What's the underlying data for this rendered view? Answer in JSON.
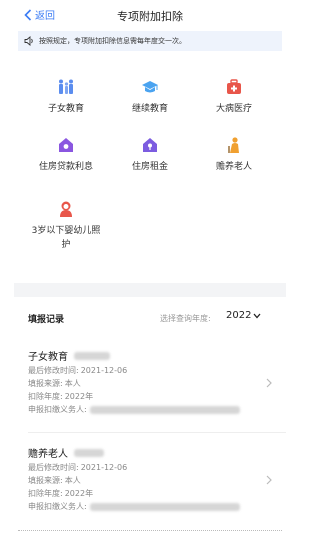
{
  "nav": {
    "back_label": "返回",
    "title": "专项附加扣除"
  },
  "notice": {
    "text": "按照规定，专项附加扣除信息需每年度交一次。"
  },
  "categories": [
    {
      "label": "子女教育",
      "icon": "children-education-icon",
      "color": "#5b8def"
    },
    {
      "label": "继续教育",
      "icon": "graduation-cap-icon",
      "color": "#4aa3f0"
    },
    {
      "label": "大病医疗",
      "icon": "medical-kit-icon",
      "color": "#e8564a"
    },
    {
      "label": "住房贷款利息",
      "icon": "house-loan-icon",
      "color": "#8a56e0"
    },
    {
      "label": "住房租金",
      "icon": "house-rent-icon",
      "color": "#7c5ce0"
    },
    {
      "label": "赡养老人",
      "icon": "elderly-care-icon",
      "color": "#f0a030"
    },
    {
      "label": "3岁以下婴幼儿照护",
      "label_line1": "3岁以下婴幼儿照",
      "label_line2": "护",
      "icon": "infant-care-icon",
      "color": "#e8564a"
    }
  ],
  "records": {
    "title": "填报记录",
    "year_label": "选择查询年度:",
    "year_value": "2022",
    "items": [
      {
        "name": "子女教育",
        "modified_label": "最后修改时间:",
        "modified_value": "2021-12-06",
        "source_label": "填报来源:",
        "source_value": "本人",
        "year_label": "扣除年度:",
        "year_value": "2022年",
        "agent_label": "申报扣缴义务人:"
      },
      {
        "name": "赡养老人",
        "modified_label": "最后修改时间:",
        "modified_value": "2021-12-06",
        "source_label": "填报来源:",
        "source_value": "本人",
        "year_label": "扣除年度:",
        "year_value": "2022年",
        "agent_label": "申报扣缴义务人:"
      }
    ]
  },
  "colors": {
    "accent": "#3b7cf5",
    "notice_bg": "#eef3fc",
    "separator": "#f3f4f6"
  }
}
